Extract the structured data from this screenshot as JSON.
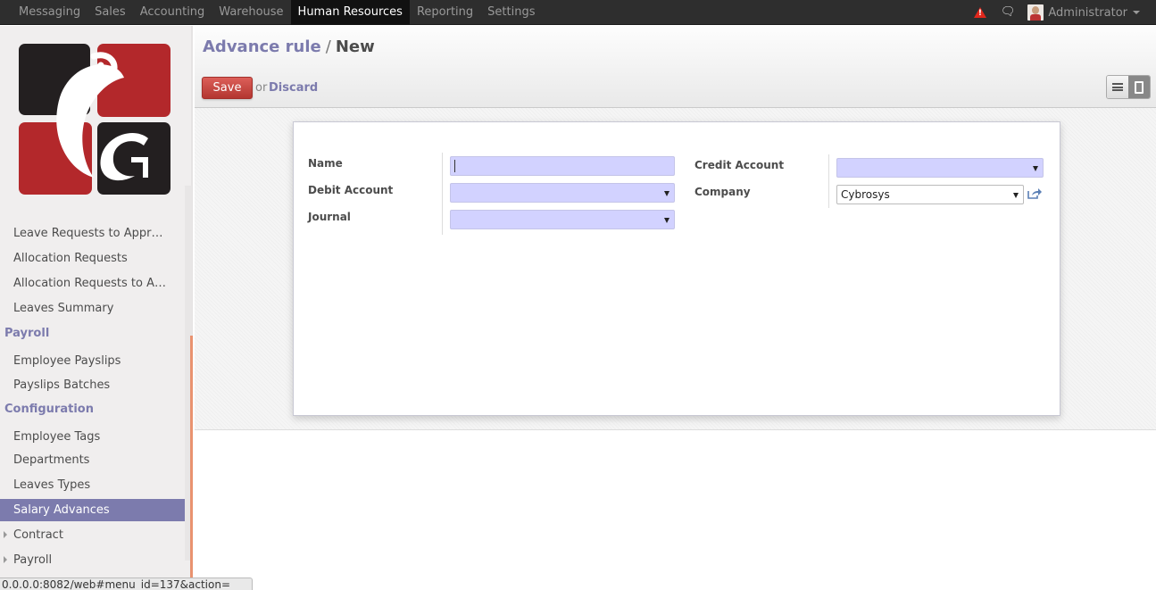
{
  "topbar": {
    "menu": [
      "Messaging",
      "Sales",
      "Accounting",
      "Warehouse",
      "Human Resources",
      "Reporting",
      "Settings"
    ],
    "active_menu": "Human Resources",
    "user_name": "Administrator",
    "alert_glyph": "!",
    "alert_color": "#e0271c",
    "chat_glyph": "🗨"
  },
  "sidebar": {
    "items": [
      {
        "type": "item",
        "label": "Leave Requests to Appr…",
        "active": false
      },
      {
        "type": "item",
        "label": "Allocation Requests",
        "active": false
      },
      {
        "type": "item",
        "label": "Allocation Requests to A…",
        "active": false
      },
      {
        "type": "item",
        "label": "Leaves Summary",
        "active": false
      },
      {
        "type": "header",
        "label": "Payroll"
      },
      {
        "type": "item",
        "label": "Employee Payslips",
        "active": false
      },
      {
        "type": "item",
        "label": "Payslips Batches",
        "active": false
      },
      {
        "type": "header",
        "label": "Configuration"
      },
      {
        "type": "item",
        "label": "Employee Tags",
        "active": false
      },
      {
        "type": "item",
        "label": "Departments",
        "active": false
      },
      {
        "type": "item",
        "label": "Leaves Types",
        "active": false
      },
      {
        "type": "item",
        "label": "Salary Advances",
        "active": true
      },
      {
        "type": "item",
        "label": "Contract",
        "collapsible": true
      },
      {
        "type": "item",
        "label": "Payroll",
        "collapsible": true
      }
    ],
    "active_color": "#7c7bad",
    "header_color": "#7c7bad"
  },
  "header": {
    "breadcrumb_parent": "Advance rule",
    "breadcrumb_sep": "/",
    "breadcrumb_current": "New",
    "save_label": "Save",
    "or_label": "or",
    "discard_label": "Discard",
    "save_color": "#c9413b"
  },
  "form": {
    "name_label": "Name",
    "name_value": "",
    "debit_label": "Debit Account",
    "debit_value": "",
    "journal_label": "Journal",
    "journal_value": "",
    "credit_label": "Credit Account",
    "credit_value": "",
    "company_label": "Company",
    "company_value": "Cybrosys",
    "required_color": "#d2d2ff"
  },
  "statusbar": {
    "url": "0.0.0.0:8082/web#menu_id=137&action="
  }
}
